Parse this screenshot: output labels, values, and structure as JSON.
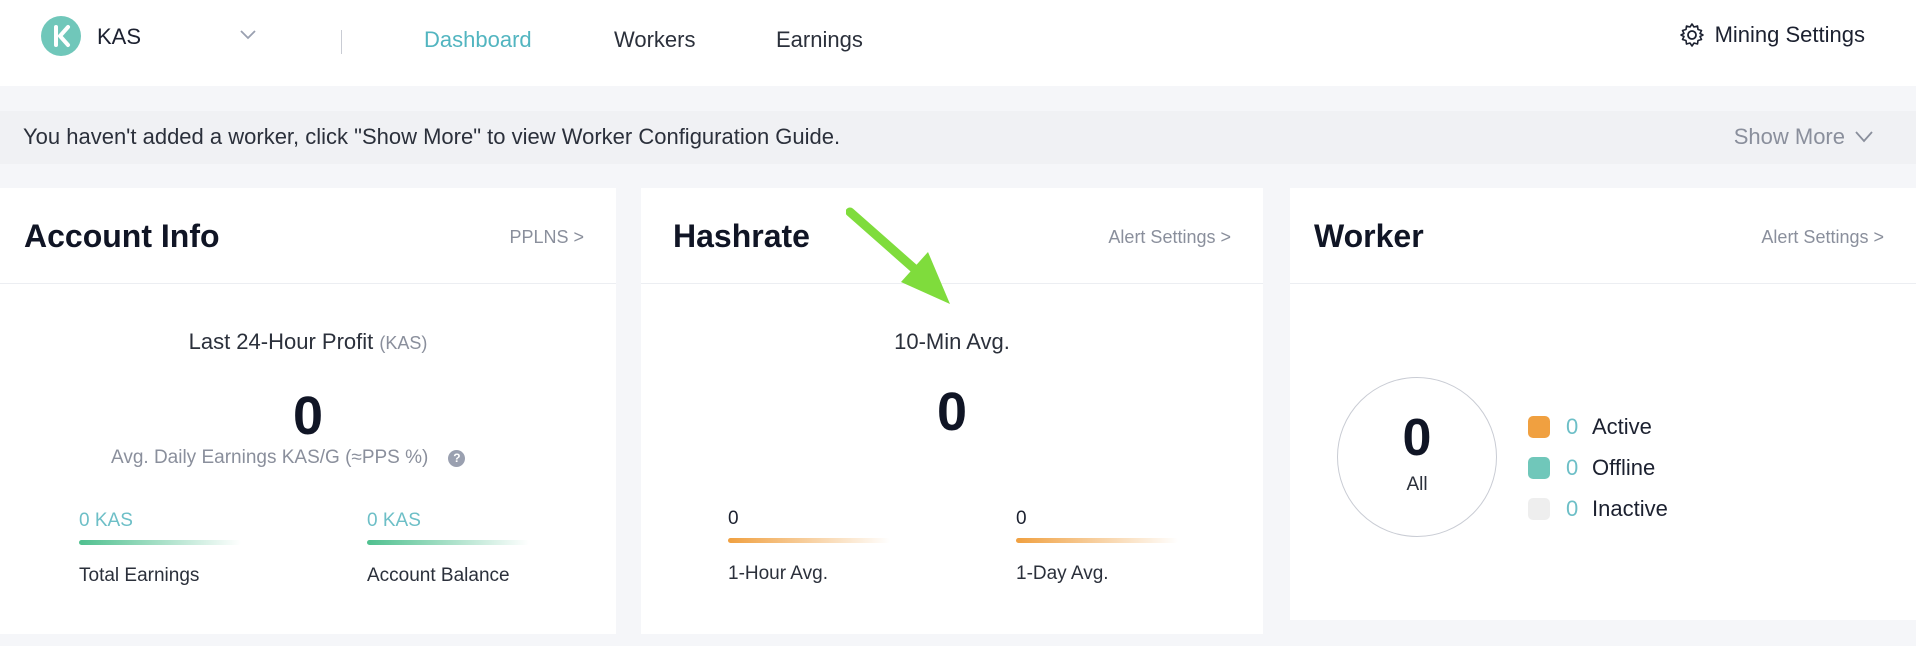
{
  "header": {
    "coin": "KAS",
    "tabs": [
      {
        "label": "Dashboard"
      },
      {
        "label": "Workers"
      },
      {
        "label": "Earnings"
      }
    ],
    "settings_label": "Mining Settings"
  },
  "notice": {
    "text": "You haven't added a worker, click \"Show More\" to view Worker Configuration Guide.",
    "show_more": "Show More"
  },
  "account": {
    "title": "Account Info",
    "link": "PPLNS >",
    "profit_label": "Last 24-Hour Profit",
    "profit_unit": "(KAS)",
    "profit_value": "0",
    "hint": "Avg. Daily Earnings KAS/G (≈PPS %)",
    "total_value": "0 KAS",
    "total_label": "Total Earnings",
    "balance_value": "0 KAS",
    "balance_label": "Account Balance"
  },
  "hashrate": {
    "title": "Hashrate",
    "link": "Alert Settings >",
    "avg10_label": "10-Min Avg.",
    "avg10_value": "0",
    "hour_value": "0",
    "hour_label": "1-Hour Avg.",
    "day_value": "0",
    "day_label": "1-Day Avg."
  },
  "worker": {
    "title": "Worker",
    "link": "Alert Settings >",
    "total": "0",
    "total_label": "All",
    "legend": [
      {
        "count": "0",
        "label": "Active",
        "color": "#f0a040"
      },
      {
        "count": "0",
        "label": "Offline",
        "color": "#70c7ba"
      },
      {
        "count": "0",
        "label": "Inactive",
        "color": "#eeeeee"
      }
    ]
  },
  "colors": {
    "accent": "#52b5c0",
    "arrow": "#7fdc3c"
  }
}
